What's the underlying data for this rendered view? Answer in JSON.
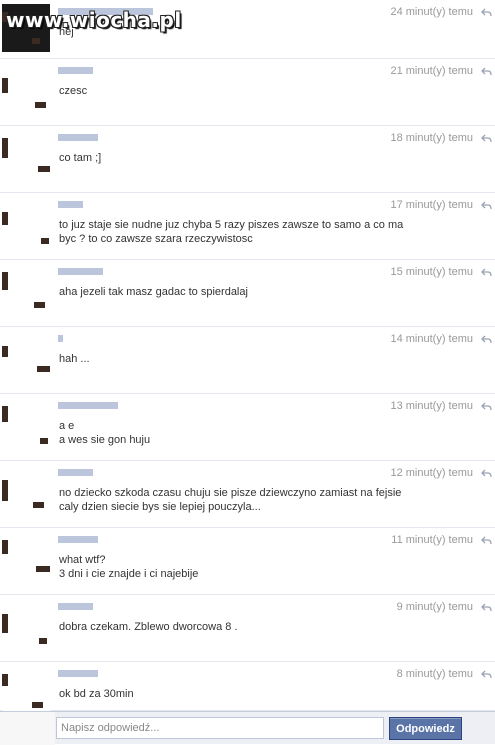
{
  "watermark": "www.wiocha.pl",
  "messages": [
    {
      "time": "24 minut(y) temu",
      "lines": [
        "hej"
      ]
    },
    {
      "time": "21 minut(y) temu",
      "lines": [
        "czesc"
      ]
    },
    {
      "time": "18 minut(y) temu",
      "lines": [
        "co tam ;]"
      ]
    },
    {
      "time": "17 minut(y) temu",
      "lines": [
        "to juz staje sie nudne juz chyba 5 razy piszes zawsze to samo a co ma",
        "byc ? to co zawsze szara rzeczywistosc"
      ]
    },
    {
      "time": "15 minut(y) temu",
      "lines": [
        "aha jezeli tak masz gadac to spierdalaj"
      ]
    },
    {
      "time": "14 minut(y) temu",
      "lines": [
        "hah ..."
      ]
    },
    {
      "time": "13 minut(y) temu",
      "lines": [
        "a e",
        "a wes sie gon huju"
      ]
    },
    {
      "time": "12 minut(y) temu",
      "lines": [
        "no dziecko szkoda czasu chuju sie pisze dziewczyno zamiast na fejsie",
        "caly dzien siecie bys sie lepiej pouczyla..."
      ]
    },
    {
      "time": "11 minut(y) temu",
      "lines": [
        "what wtf?",
        "3 dni i cie znajde i ci najebije"
      ]
    },
    {
      "time": "9 minut(y) temu",
      "lines": [
        "dobra czekam. Zblewo dworcowa 8 ."
      ]
    },
    {
      "time": "8 minut(y) temu",
      "lines": [
        "ok bd za 30min"
      ]
    }
  ],
  "composer": {
    "placeholder": "Napisz odpowiedź...",
    "submit_label": "Odpowiedz"
  },
  "colors": {
    "accent": "#5b74a8",
    "timestamp": "#999999",
    "divider": "#e4e7ee"
  }
}
